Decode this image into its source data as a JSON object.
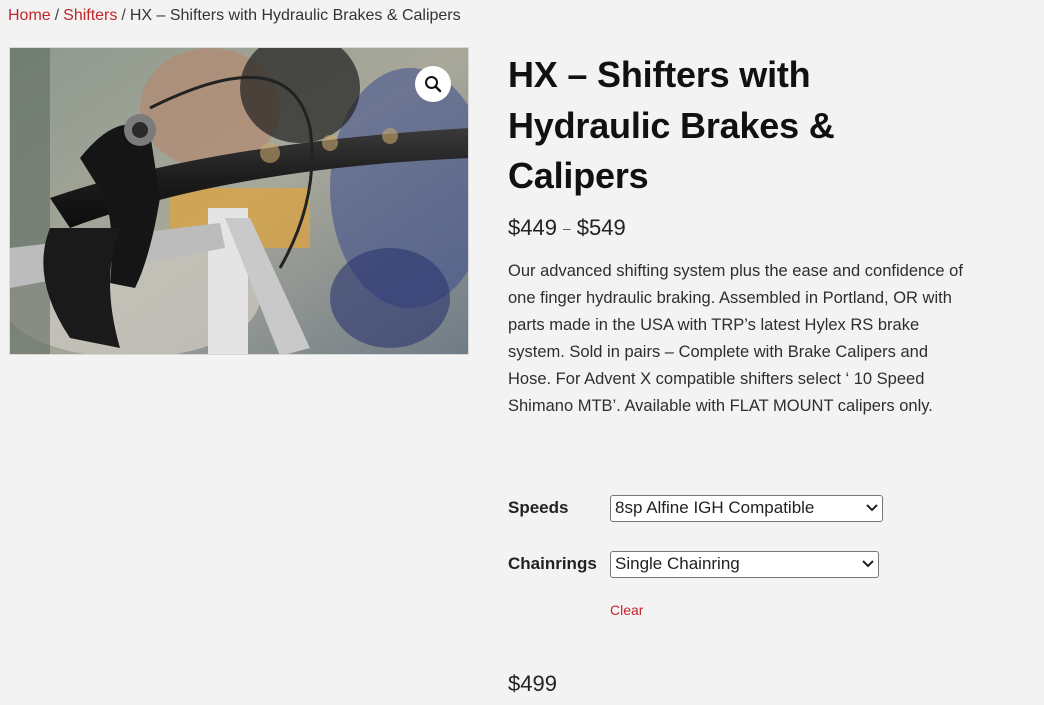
{
  "breadcrumb": {
    "home": "Home",
    "category": "Shifters",
    "current": "HX – Shifters with Hydraulic Brakes & Calipers",
    "separator": "/"
  },
  "product": {
    "title": "HX – Shifters with Hydraulic Brakes & Calipers",
    "price_min": "$449",
    "price_sep": "–",
    "price_max": "$549",
    "description": "Our advanced shifting system plus the ease and confidence of one finger hydraulic braking.  Assembled in Portland, OR with parts made in the USA with TRP’s latest Hylex RS brake system. Sold in pairs – Complete with Brake Calipers and Hose. For Advent X compatible shifters select ‘ 10 Speed Shimano MTB’. Available with FLAT MOUNT calipers only.",
    "zoom_icon": "magnifier-icon"
  },
  "variations": {
    "speeds_label": "Speeds",
    "speeds_value": "8sp Alfine IGH Compatible",
    "chainrings_label": "Chainrings",
    "chainrings_value": "Single Chainring",
    "clear_label": "Clear"
  },
  "selected_price": "$499",
  "colors": {
    "link": "#c0262c",
    "background": "#f3f3f3",
    "title": "#111111"
  }
}
